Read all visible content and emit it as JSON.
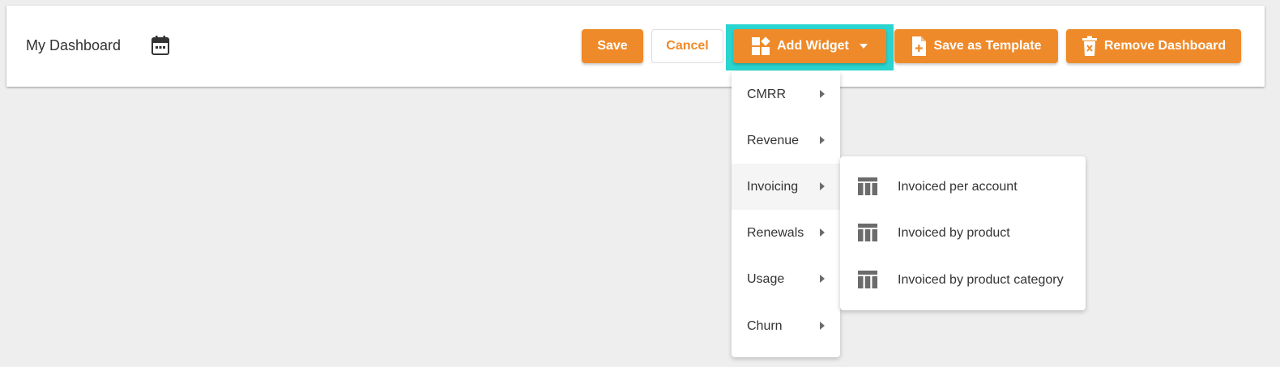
{
  "header": {
    "title": "My Dashboard",
    "calendar_icon": "calendar-icon"
  },
  "toolbar": {
    "save_label": "Save",
    "cancel_label": "Cancel",
    "add_widget_label": "Add Widget",
    "save_template_label": "Save as Template",
    "remove_dashboard_label": "Remove Dashboard"
  },
  "widget_menu": {
    "items": [
      {
        "label": "CMRR"
      },
      {
        "label": "Revenue"
      },
      {
        "label": "Invoicing",
        "active": true
      },
      {
        "label": "Renewals"
      },
      {
        "label": "Usage"
      },
      {
        "label": "Churn"
      }
    ]
  },
  "invoicing_submenu": {
    "items": [
      {
        "label": "Invoiced per account",
        "icon": "table-icon"
      },
      {
        "label": "Invoiced by product",
        "icon": "table-icon"
      },
      {
        "label": "Invoiced by product category",
        "icon": "table-icon"
      }
    ]
  },
  "colors": {
    "accent": "#ef8a2a",
    "highlight": "#2ad4cf",
    "background": "#eeeeee"
  }
}
